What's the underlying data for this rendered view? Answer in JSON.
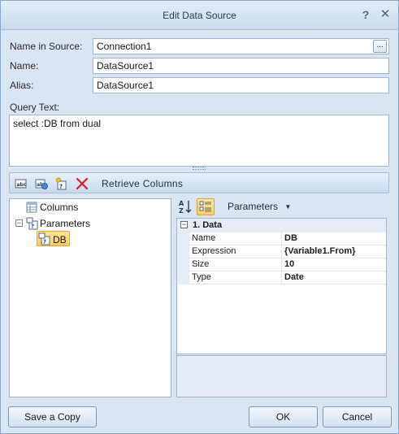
{
  "window": {
    "title": "Edit Data Source",
    "help_glyph": "?",
    "close_glyph": "✕"
  },
  "form": {
    "name_in_source_label": "Name in Source:",
    "name_in_source_value": "Connection1",
    "ellipsis": "...",
    "name_label": "Name:",
    "name_value": "DataSource1",
    "alias_label": "Alias:",
    "alias_value": "DataSource1",
    "query_label": "Query Text:",
    "query_value": "select :DB from dual"
  },
  "toolbar": {
    "icons": [
      "new-column-icon",
      "new-calc-column-icon",
      "new-parameter-icon",
      "delete-icon"
    ],
    "retrieve_label": "Retrieve Columns"
  },
  "tree": {
    "columns_label": "Columns",
    "parameters_label": "Parameters",
    "parameter_item": "DB",
    "toggle_glyph": "⊟"
  },
  "properties": {
    "dropdown_label": "Parameters",
    "category_label": "1. Data",
    "rows": [
      {
        "name": "Name",
        "value": "DB"
      },
      {
        "name": "Expression",
        "value": "{Variable1.From}"
      },
      {
        "name": "Size",
        "value": "10"
      },
      {
        "name": "Type",
        "value": "Date"
      }
    ]
  },
  "footer": {
    "save_copy_label": "Save a Copy",
    "ok_label": "OK",
    "cancel_label": "Cancel"
  },
  "colors": {
    "accent": "#ffcb55",
    "window_bg": "#d9e5f3",
    "delete_red": "#d21f1f"
  }
}
